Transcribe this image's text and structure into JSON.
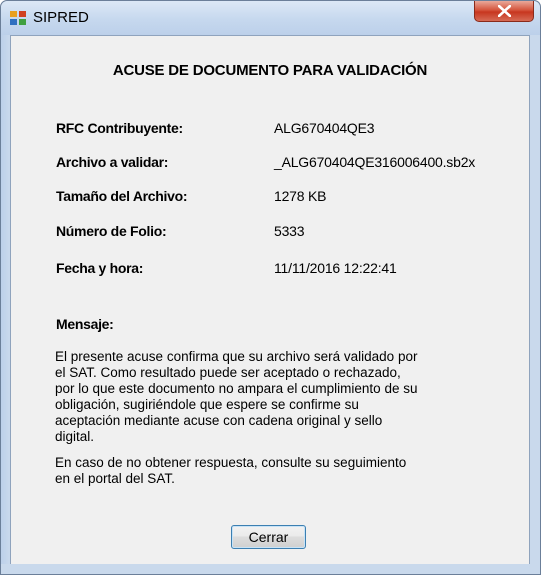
{
  "window": {
    "title": "SIPRED",
    "icon": "sipred-app-icon",
    "close_icon": "close-x-icon",
    "accent": "#c7361f"
  },
  "dialog": {
    "heading": "ACUSE DE DOCUMENTO PARA VALIDACIÓN",
    "fields": [
      {
        "label": "RFC Contribuyente:",
        "value": "ALG670404QE3"
      },
      {
        "label": "Archivo a validar:",
        "value": "_ALG670404QE316006400.sb2x"
      },
      {
        "label": "Tamaño del Archivo:",
        "value": "1278 KB"
      },
      {
        "label": "Número de Folio:",
        "value": "5333"
      },
      {
        "label": "Fecha y hora:",
        "value": "11/11/2016 12:22:41"
      }
    ],
    "message_label": "Mensaje:",
    "message_p1": "El presente acuse confirma que su archivo será validado por\nel SAT. Como resultado puede ser aceptado o rechazado,\npor lo que este documento no ampara el cumplimiento de su\nobligación, sugiriéndole que espere se confirme su\naceptación mediante acuse con cadena original y sello\ndigital.",
    "message_p2": "En caso de no obtener respuesta, consulte su seguimiento\nen el portal del SAT.",
    "close_button": "Cerrar"
  }
}
